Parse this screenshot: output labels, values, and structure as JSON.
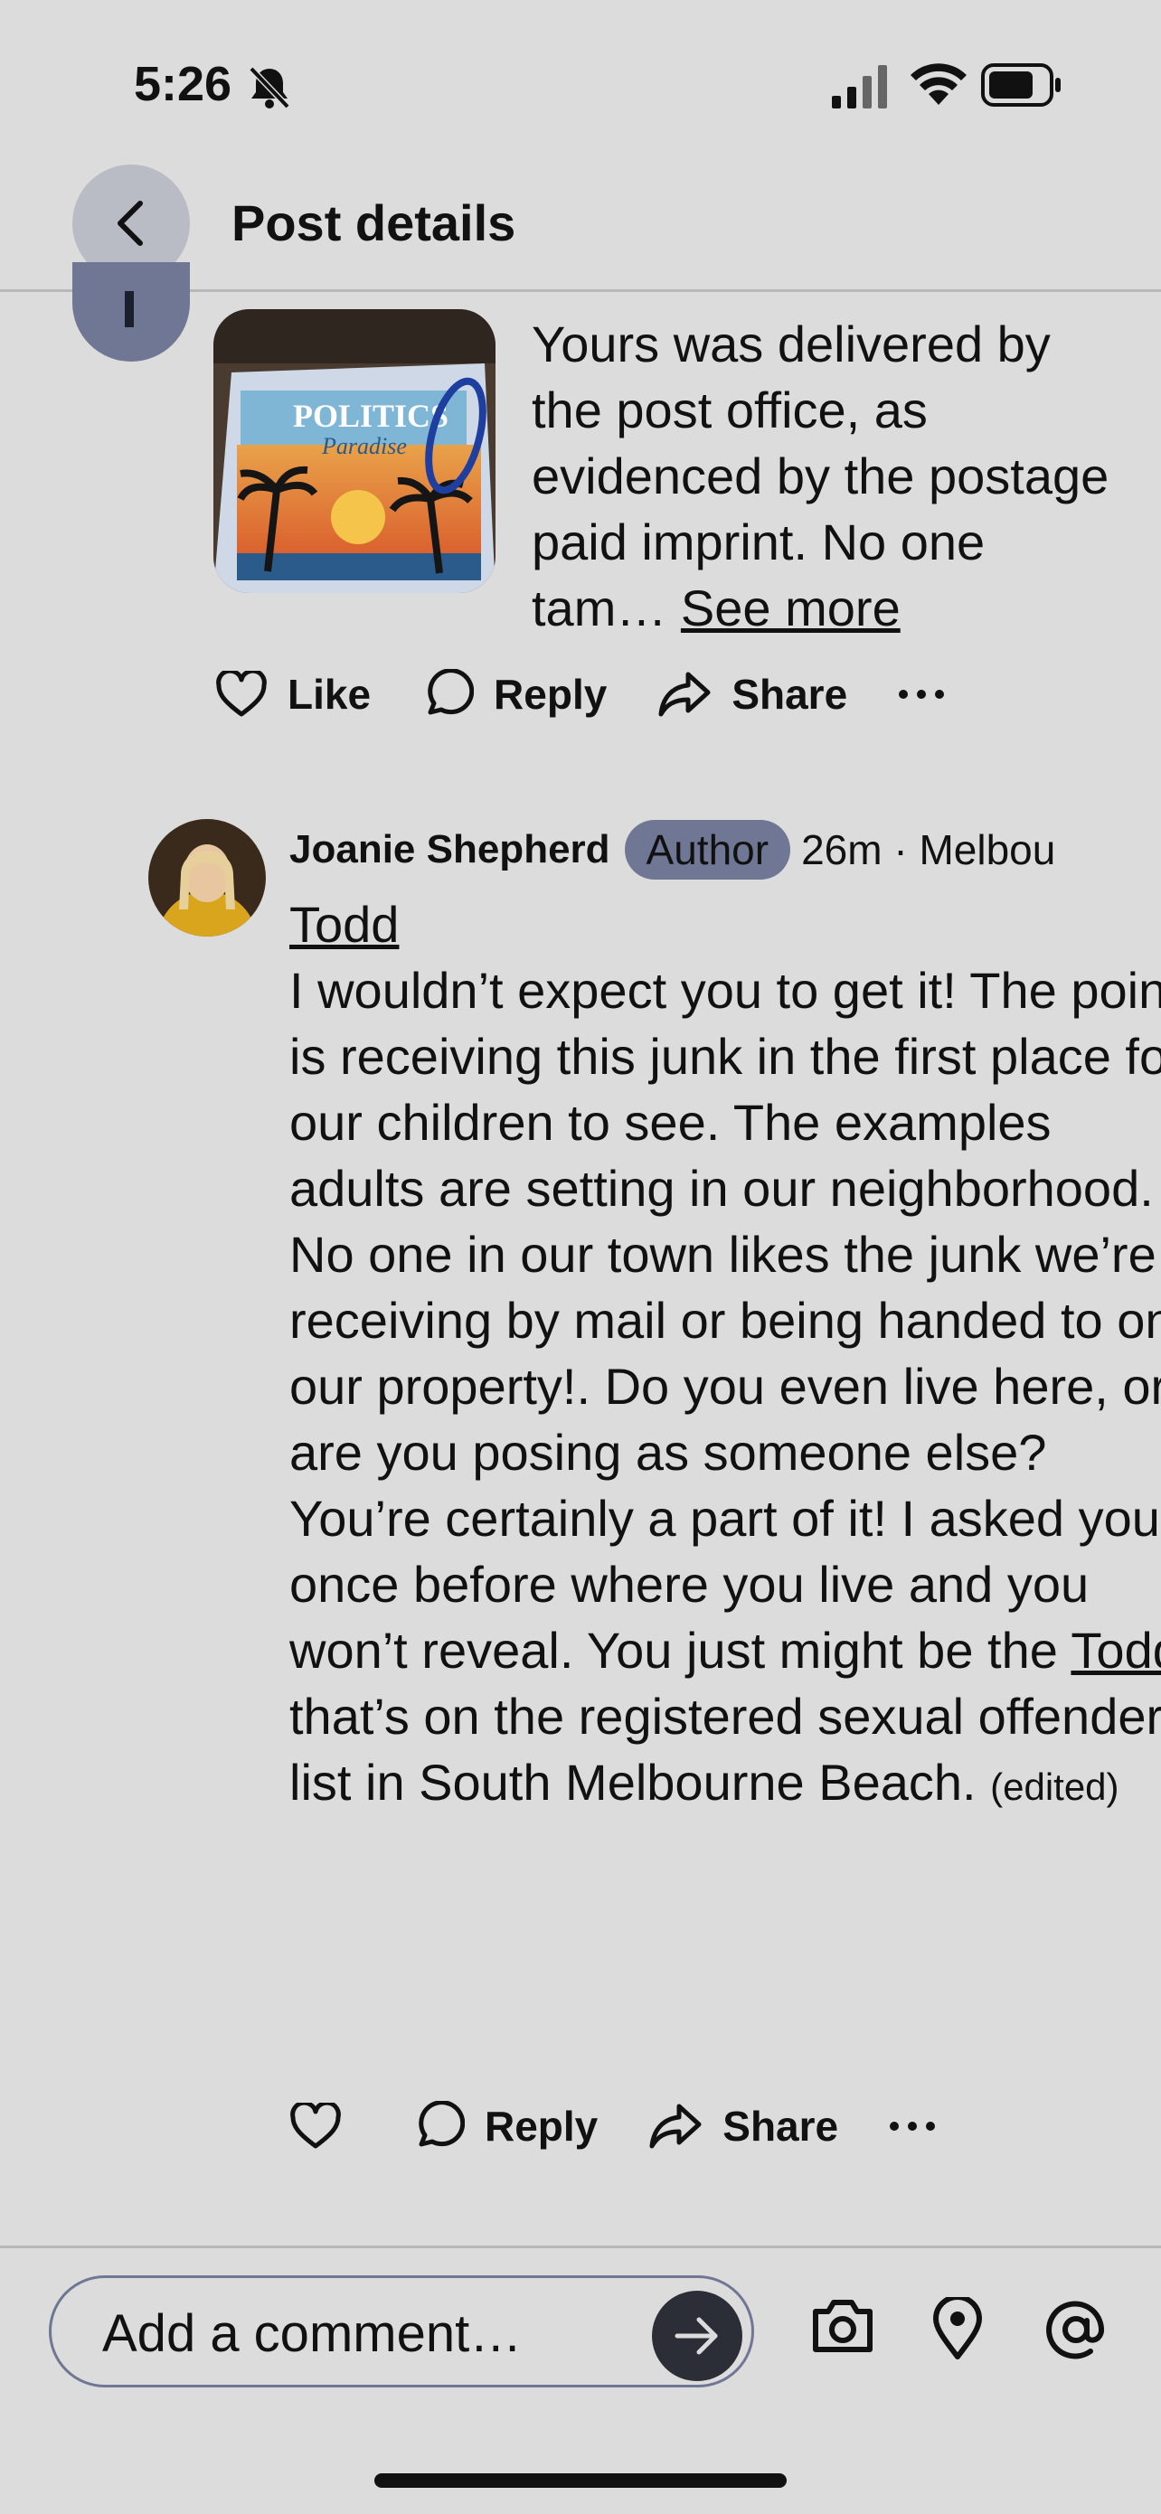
{
  "status": {
    "time": "5:26"
  },
  "header": {
    "title": "Post details"
  },
  "prev_comment": {
    "text": "Yours was delivered by the post office, as evidenced by the postage paid imprint. No one tam…",
    "see_more": "See more",
    "image_text": "POLITICS Paradise",
    "actions": {
      "like": "Like",
      "reply": "Reply",
      "share": "Share"
    }
  },
  "comment": {
    "author": "Joanie Shepherd",
    "badge": "Author",
    "meta": "26m · Melbou",
    "mention": "Todd",
    "body_part1": "I wouldn’t expect you to get it! The point is receiving this junk in the first place for our children to see. The examples adults are setting in our neighborhood. No one in our town likes the junk we’re receiving by mail or being handed to on our property!. Do you even live here, or are you posing as someone else? You’re certainly a part of it! I asked you once before where you live and you won’t reveal. You just might be the",
    "mention2": "Todd",
    "body_part2": "that’s on  the registered sexual offender list in South Melbourne Beach.",
    "edited": "(edited)",
    "actions": {
      "reply": "Reply",
      "share": "Share"
    }
  },
  "footer": {
    "placeholder": "Add a comment…"
  },
  "colors": {
    "background": "#dcdcdc",
    "accent": "#6f7794",
    "send": "#2b2e37"
  }
}
